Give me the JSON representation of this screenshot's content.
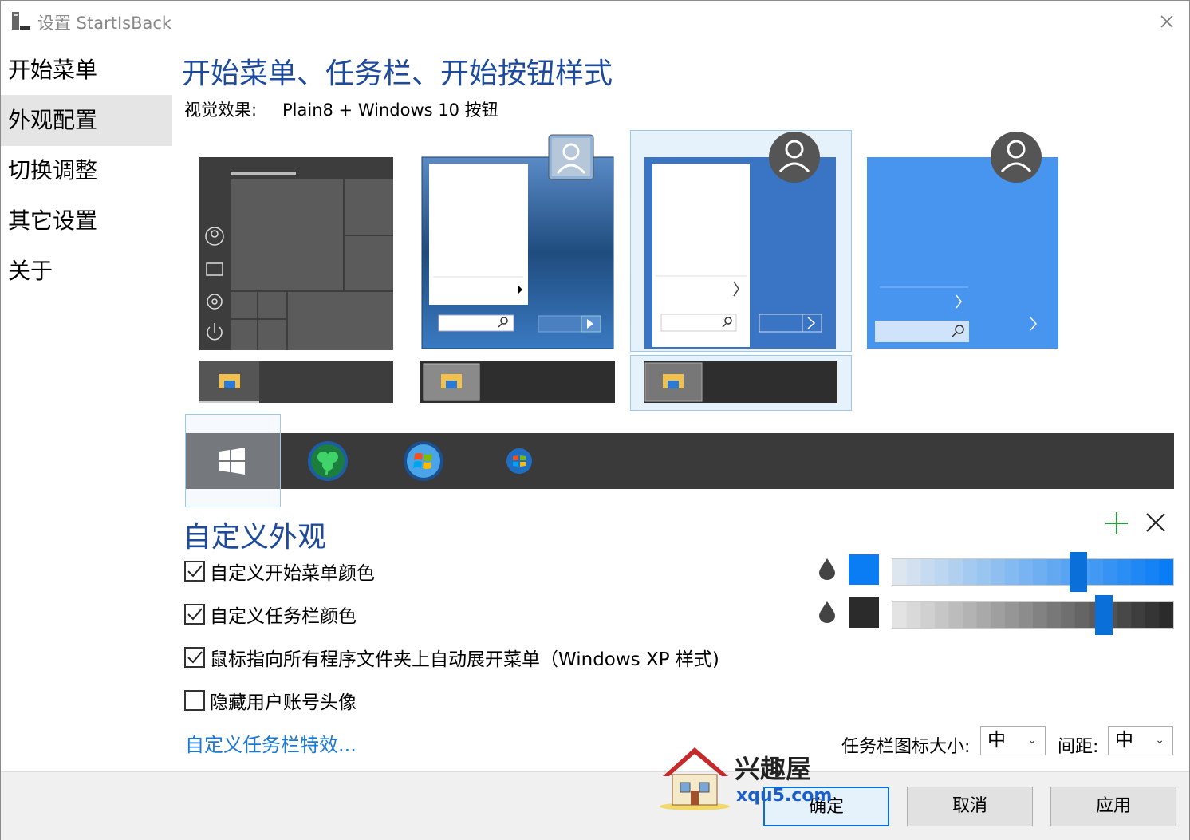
{
  "window": {
    "title": "设置 StartIsBack"
  },
  "sidebar": {
    "items": [
      {
        "label": "开始菜单"
      },
      {
        "label": "外观配置"
      },
      {
        "label": "切换调整"
      },
      {
        "label": "其它设置"
      },
      {
        "label": "关于"
      }
    ],
    "active_index": 1
  },
  "main": {
    "section_title": "开始菜单、任务栏、开始按钮样式",
    "visual_effect_label": "视觉效果:",
    "visual_effect_value": "Plain8 + Windows 10 按钮",
    "selected_style_index": 2,
    "selected_orb_index": 0,
    "customize_title": "自定义外观",
    "checkboxes": [
      {
        "label": "自定义开始菜单颜色",
        "checked": true
      },
      {
        "label": "自定义任务栏颜色",
        "checked": true
      },
      {
        "label": "鼠标指向所有程序文件夹上自动展开菜单（Windows XP 样式)",
        "checked": true
      },
      {
        "label": "隐藏用户账号头像",
        "checked": false
      }
    ],
    "taskbar_effects_link": "自定义任务栏特效...",
    "start_menu_color": {
      "swatch": "#0a7df5",
      "slider_value": 0.66
    },
    "taskbar_color": {
      "swatch": "#2b2b2b",
      "slider_value": 0.75
    },
    "icon_size_label": "任务栏图标大小:",
    "icon_size_value": "中",
    "spacing_label": "间距:",
    "spacing_value": "中"
  },
  "footer": {
    "ok_label": "确定",
    "cancel_label": "取消",
    "apply_label": "应用"
  },
  "watermark": {
    "text": "兴趣屋",
    "url": "xqu5.com"
  },
  "colors": {
    "accent": "#0a6fd8",
    "heading": "#1e4a9c",
    "link": "#1a79d6"
  }
}
